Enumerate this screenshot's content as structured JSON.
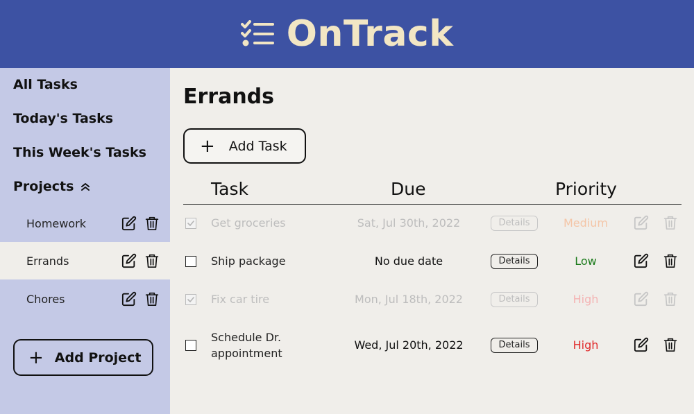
{
  "app": {
    "title": "OnTrack"
  },
  "sidebar": {
    "all_tasks": "All Tasks",
    "todays_tasks": "Today's Tasks",
    "week_tasks": "This Week's Tasks",
    "projects_label": "Projects",
    "projects": [
      {
        "name": "Homework",
        "active": false
      },
      {
        "name": "Errands",
        "active": true
      },
      {
        "name": "Chores",
        "active": false
      }
    ],
    "add_project_label": "Add Project",
    "add_project_icon": "+"
  },
  "main": {
    "title": "Errands",
    "add_task_label": "Add Task",
    "add_task_icon": "+",
    "columns": {
      "task": "Task",
      "due": "Due",
      "priority": "Priority"
    },
    "details_label": "Details",
    "tasks": [
      {
        "name": "Get groceries",
        "due": "Sat, Jul 30th, 2022",
        "priority": "Medium",
        "done": true,
        "priority_color": "#f4c6a8"
      },
      {
        "name": "Ship package",
        "due": "No due date",
        "priority": "Low",
        "done": false,
        "priority_color": "#1a7a1a"
      },
      {
        "name": "Fix car tire",
        "due": "Mon, Jul 18th, 2022",
        "priority": "High",
        "done": true,
        "priority_color": "#f4b3b3"
      },
      {
        "name": "Schedule Dr. appointment",
        "due": "Wed, Jul 20th, 2022",
        "priority": "High",
        "done": false,
        "priority_color": "#e02a2a"
      }
    ]
  },
  "colors": {
    "header_bg": "#3d52a3",
    "brand_text": "#f2e6c4",
    "sidebar_bg": "#c4c9e6",
    "main_bg": "#f0eeea"
  },
  "icons": {
    "logo": "checklist-icon",
    "edit": "edit-icon",
    "delete": "trash-icon",
    "collapse": "chevron-up-icon"
  }
}
